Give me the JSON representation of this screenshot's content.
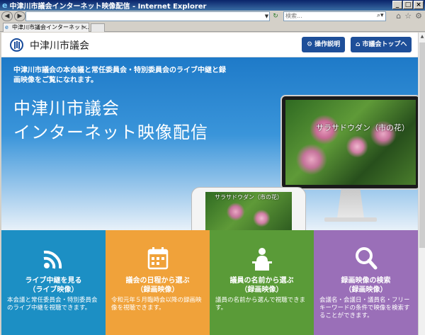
{
  "browser": {
    "window_title": "中津川市議会インターネット映像配信 - Internet Explorer",
    "search_placeholder": "検索...",
    "tab_label": "中津川市議会インターネット..."
  },
  "header": {
    "site_name": "中津川市議会",
    "buttons": [
      {
        "label": "操作説明",
        "icon": "gear-icon"
      },
      {
        "label": "市議会トップへ",
        "icon": "home-icon"
      }
    ]
  },
  "hero": {
    "intro": "中津川市議会の本会議と常任委員会・特別委員会のライブ中継と録画映像をご覧になれます。",
    "title_line1": "中津川市議会",
    "title_line2": "インターネット映像配信",
    "monitor_caption": "サラサドウダン（市の花）",
    "phone_caption": "サラサドウダン（市の花）"
  },
  "cards": [
    {
      "title_line1": "ライブ中継を見る",
      "title_line2": "（ライブ映像）",
      "desc": "本会議と常任委員会・特別委員会のライブ中継を視聴できます。",
      "color": "#1c8fc4",
      "icon": "wifi-icon"
    },
    {
      "title_line1": "議会の日程から選ぶ",
      "title_line2": "（録画映像）",
      "desc": "令和元年５月臨時会以降の録画映像を視聴できます。",
      "color": "#f0a23a",
      "icon": "calendar-icon"
    },
    {
      "title_line1": "議員の名前から選ぶ",
      "title_line2": "（録画映像）",
      "desc": "議員の名前から選んで視聴できます。",
      "color": "#5a9b38",
      "icon": "speaker-icon"
    },
    {
      "title_line1": "録画映像の検索",
      "title_line2": "（録画映像）",
      "desc": "会議名・会議日・議員名・フリーキーワードの条件で映像を検索することができます。",
      "color": "#9a6fb8",
      "icon": "search-icon"
    }
  ]
}
